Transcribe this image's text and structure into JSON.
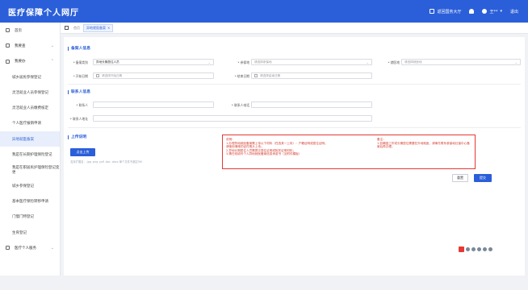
{
  "header": {
    "title": "医疗保障个人网厅",
    "return_hall": "返回国务大厅",
    "user_name": "王**",
    "logout": "退出"
  },
  "sidebar": {
    "items": [
      {
        "label": "首页",
        "icon": "home-icon",
        "level": 0
      },
      {
        "label": "我要查",
        "icon": "search-icon",
        "level": 0,
        "expandable": true
      },
      {
        "label": "我要办",
        "icon": "folder-icon",
        "level": 0,
        "expandable": true,
        "expanded": true
      },
      {
        "label": "城乡居民参保登记",
        "level": 1
      },
      {
        "label": "灵活就业人员参保登记",
        "level": 1
      },
      {
        "label": "灵活就业人员缴费核定",
        "level": 1
      },
      {
        "label": "个人医疗报销申请",
        "level": 1
      },
      {
        "label": "异地就医备案",
        "level": 1,
        "active": true
      },
      {
        "label": "我是在长期护理保险登记",
        "level": 1
      },
      {
        "label": "我是在职居民护理保险登记变更",
        "level": 1
      },
      {
        "label": "城乡参保登记",
        "level": 1
      },
      {
        "label": "基本医疗保险转移申请",
        "level": 1
      },
      {
        "label": "门慢门特登记",
        "level": 1
      },
      {
        "label": "生育登记",
        "level": 1
      },
      {
        "label": "医疗个人服务",
        "icon": "person-icon",
        "level": 0,
        "expandable": true
      }
    ]
  },
  "tabbar": {
    "home_crumb": "首页",
    "active_tab": "异地就医备案",
    "close": "×"
  },
  "form": {
    "sections": {
      "applicant": "备案人信息",
      "contact": "联系人信息",
      "upload": "上传说明"
    },
    "labels": {
      "record_type": "* 备案类别",
      "insured_place": "* 参保地",
      "settle_place": "* 就医地",
      "start_date": "* 开始日期",
      "end_date": "* 结束日期",
      "contact_name": "* 联系人",
      "contact_phone": "* 联系人电话",
      "contact_addr": "* 联系人地址"
    },
    "values": {
      "record_type": "异地长期居住人员"
    },
    "placeholders": {
      "insured_place": "请选择参保地",
      "settle_place": "请选择就医地",
      "start_date": "请选择开始日期",
      "end_date": "请选择结束日期"
    }
  },
  "upload": {
    "button": "点击上传",
    "hint": "支持扩展名：.jpg .png .pdf .doc .docx 单个文件不超过5M"
  },
  "notice": {
    "col1": [
      "说明：",
      "1.办理异地就医备案需上传以下材料（任选其一上传）：户籍证明或居住证明；",
      "请使用清晰的证件照片上传；",
      "2.异地长期居住人员需提交居住证明或相关证明材料；",
      "3.需在线填写个人异地就医备案信息承诺书（见附件模板）"
    ],
    "col2": [
      "备注：",
      "1.如确因工作或长期居住需要在外地就医，请事先联系参保地社保中心备案后再办理。"
    ]
  },
  "actions": {
    "reset": "重置",
    "submit": "提交"
  },
  "colors": {
    "primary": "#2b5fd9",
    "notice_red": "#e53935"
  }
}
